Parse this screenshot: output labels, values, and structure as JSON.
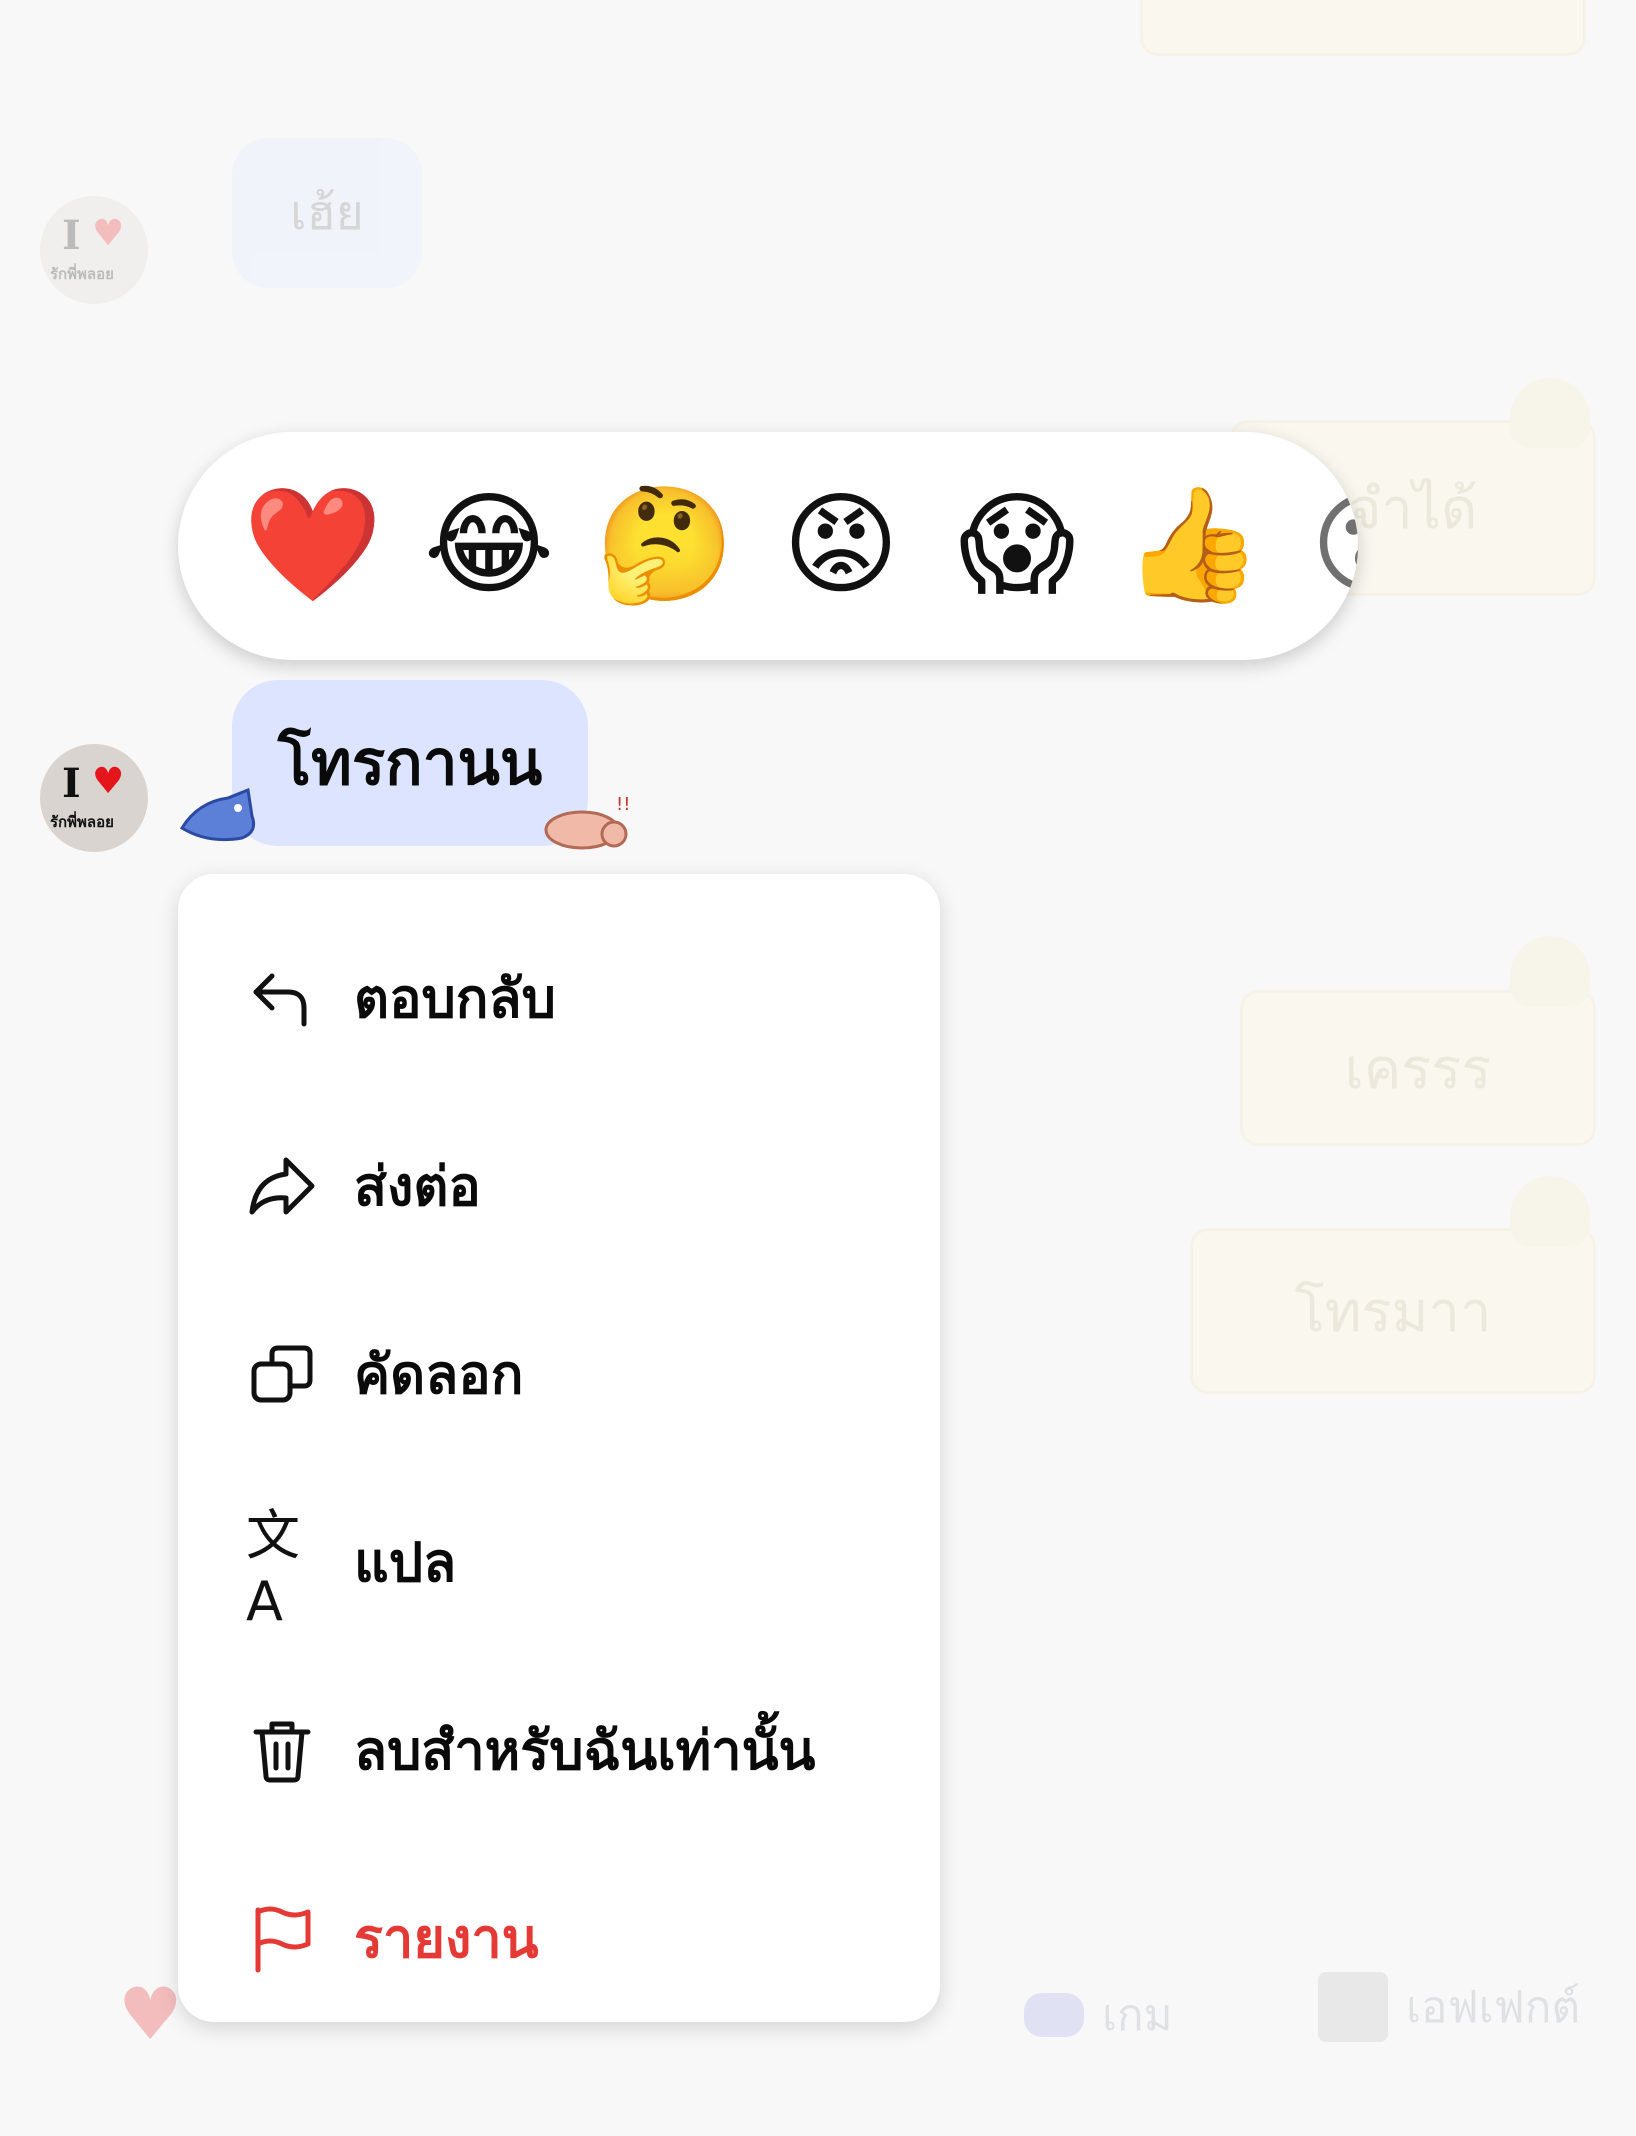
{
  "background_chat": {
    "incoming_message_1": "เฮ้ย",
    "sign_1": "จำได้",
    "sign_2": "เครรร",
    "sign_3": "โทรมาา",
    "bottom_bar": {
      "game_label": "เกม",
      "effects_label": "เอฟเฟกต์"
    }
  },
  "avatar": {
    "line1": "I",
    "heart": "♥",
    "caption": "รักพี่พลอย"
  },
  "reactions": [
    {
      "emoji": "❤️",
      "name": "heart"
    },
    {
      "emoji": "😂",
      "name": "laughing"
    },
    {
      "emoji": "🤔",
      "name": "thinking"
    },
    {
      "emoji": "😡",
      "name": "angry"
    },
    {
      "emoji": "😱",
      "name": "screaming"
    },
    {
      "emoji": "👍",
      "name": "thumbs-up"
    },
    {
      "emoji": "😮",
      "name": "surprised"
    }
  ],
  "selected_message": {
    "text": "โทรกานน"
  },
  "menu": {
    "reply": "ตอบกลับ",
    "forward": "ส่งต่อ",
    "copy": "คัดลอก",
    "translate": "แปล",
    "translate_glyph": "文A",
    "delete_for_me": "ลบสำหรับฉันเท่านั้น",
    "report": "รายงาน"
  },
  "colors": {
    "bubble": "#dde4ff",
    "danger": "#e53935",
    "sign": "#fbf1d0"
  }
}
